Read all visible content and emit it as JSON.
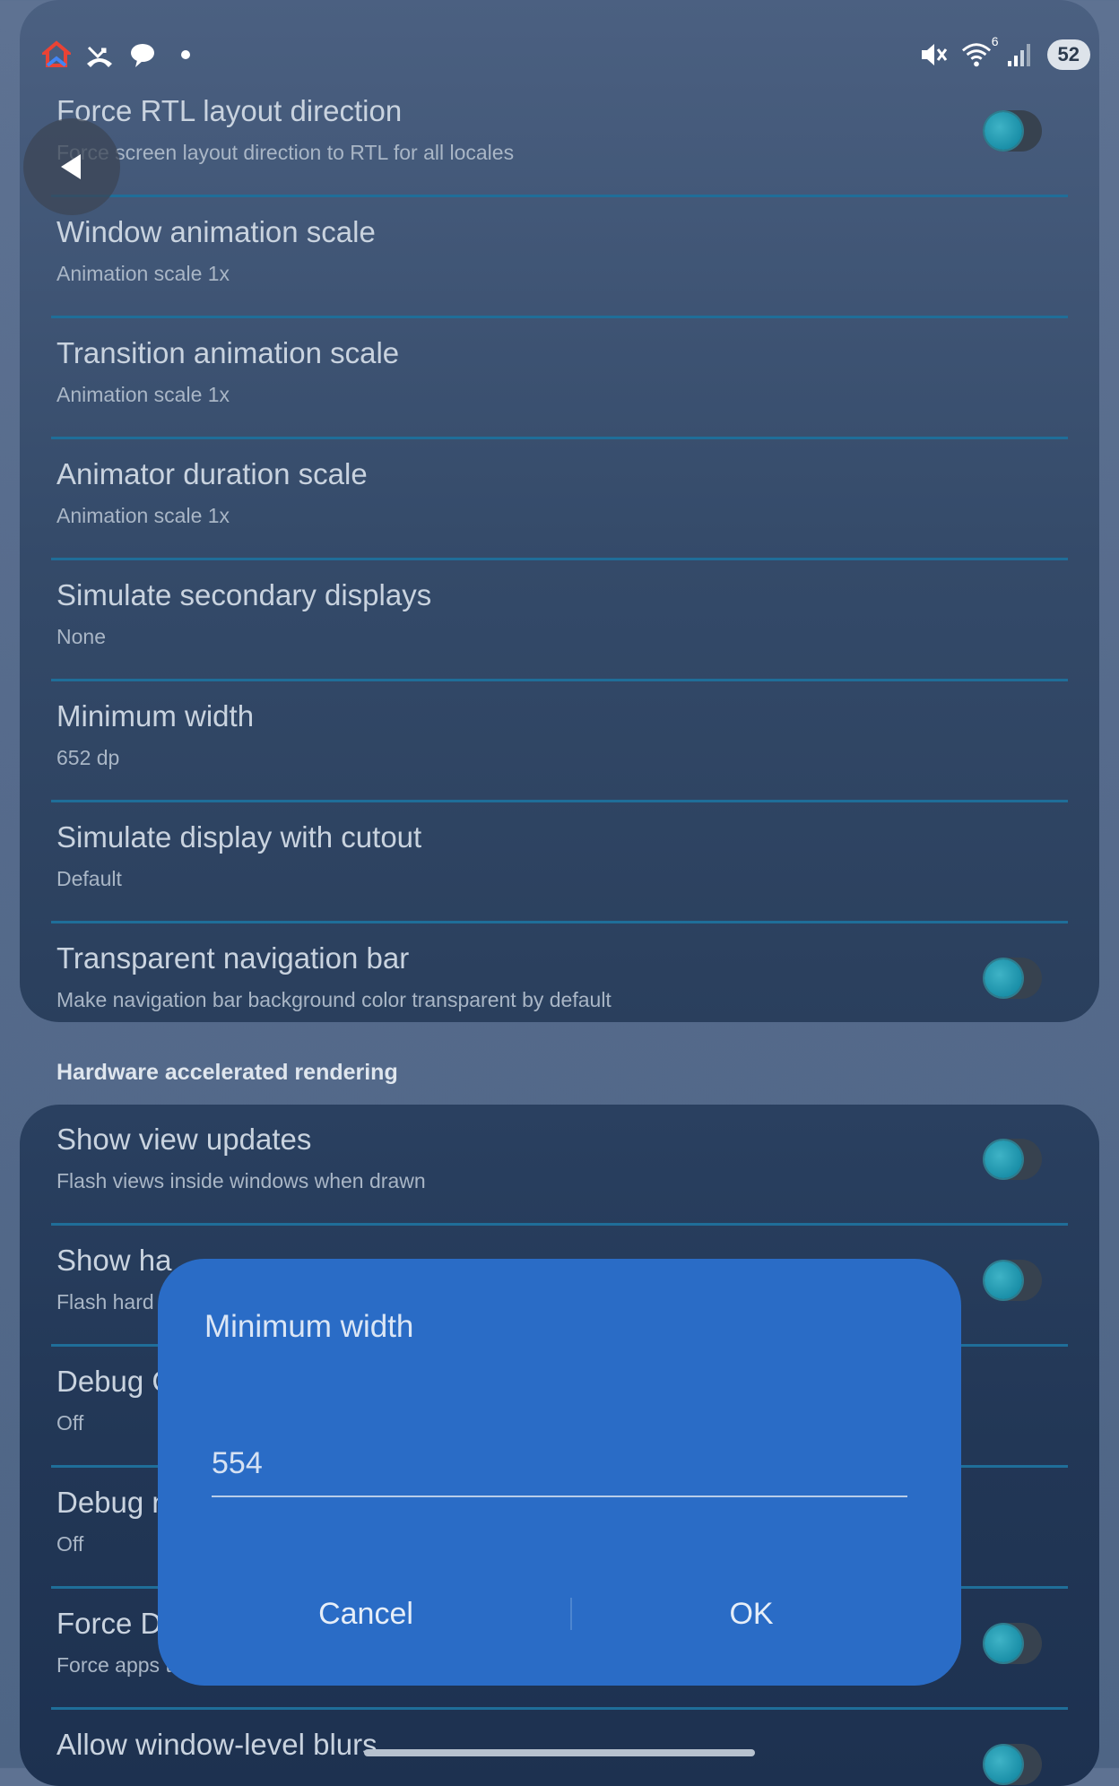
{
  "status_bar": {
    "icons_left": [
      "google-home-icon",
      "missed-call-icon",
      "chat-bubble-icon",
      "notification-dot-icon"
    ],
    "icons_right": [
      "mute-icon",
      "wifi-icon",
      "signal-icon"
    ],
    "wifi_label": "6",
    "battery": "52"
  },
  "top_section": {
    "rows": [
      {
        "title": "Force RTL layout direction",
        "subtitle": "Force screen layout direction to RTL for all locales",
        "toggle": true
      },
      {
        "title": "Window animation scale",
        "subtitle": "Animation scale 1x"
      },
      {
        "title": "Transition animation scale",
        "subtitle": "Animation scale 1x"
      },
      {
        "title": "Animator duration scale",
        "subtitle": "Animation scale 1x"
      },
      {
        "title": "Simulate secondary displays",
        "subtitle": "None"
      },
      {
        "title": "Minimum width",
        "subtitle": "652 dp"
      },
      {
        "title": "Simulate display with cutout",
        "subtitle": "Default"
      },
      {
        "title": "Transparent navigation bar",
        "subtitle": "Make navigation bar background color transparent by default",
        "toggle": true
      }
    ]
  },
  "hardware_section": {
    "header": "Hardware accelerated rendering",
    "rows": [
      {
        "title": "Show view updates",
        "subtitle": "Flash views inside windows when drawn",
        "toggle": true
      },
      {
        "title": "Show ha",
        "subtitle": "Flash hard",
        "toggle": true
      },
      {
        "title": "Debug G",
        "subtitle": "Off"
      },
      {
        "title": "Debug n",
        "subtitle": "Off"
      },
      {
        "title": "Force D",
        "subtitle": "Force apps t",
        "toggle": true
      },
      {
        "title": "Allow window-level blurs",
        "subtitle": "",
        "toggle": true
      }
    ]
  },
  "dialog": {
    "title": "Minimum width",
    "value": "554",
    "cancel": "Cancel",
    "ok": "OK"
  },
  "colors": {
    "accent": "#1a8fa8",
    "dialog_bg": "#2a6cc6",
    "divider": "#1f6e99"
  }
}
